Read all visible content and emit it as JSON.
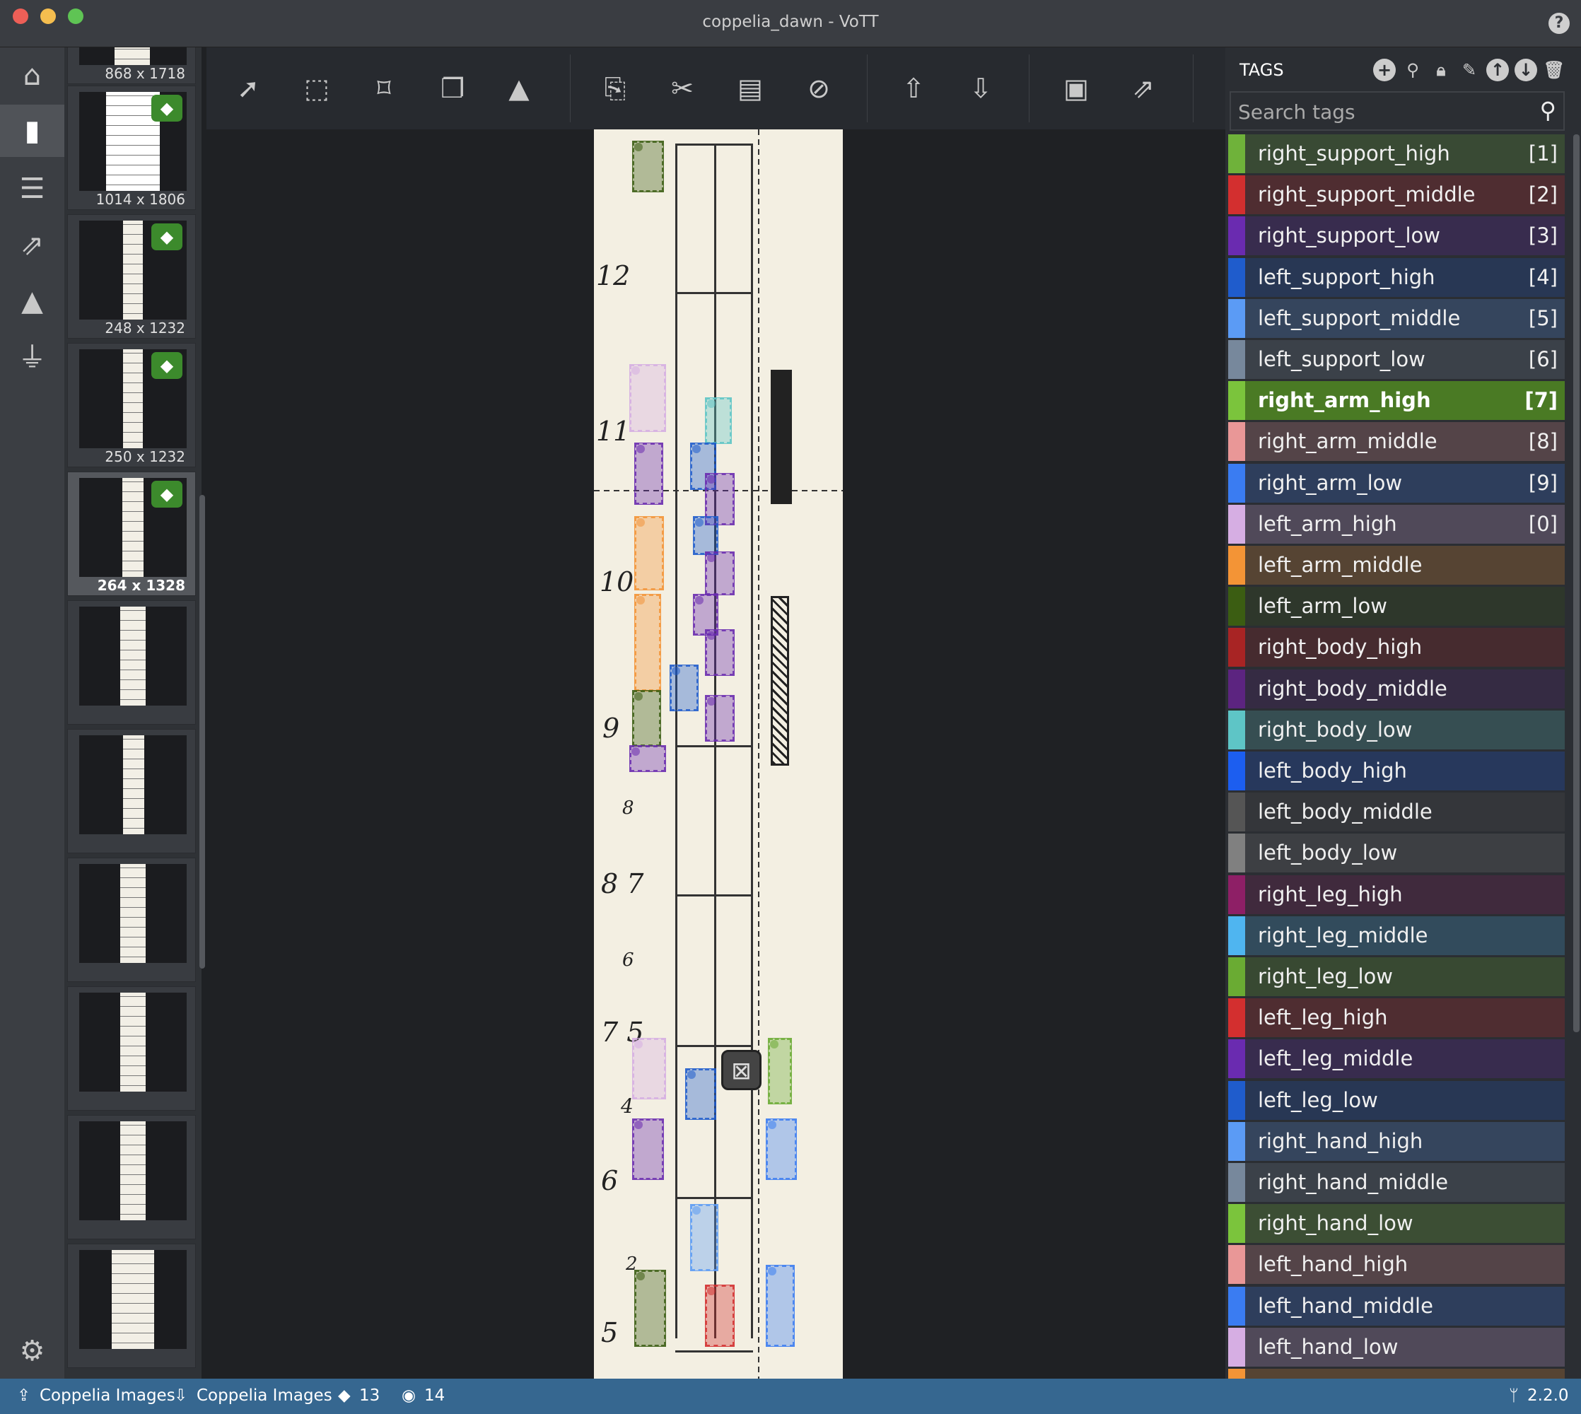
{
  "window": {
    "title": "coppelia_dawn - VoTT",
    "help_icon": "?"
  },
  "thumbnails": [
    {
      "size": "868 x 1718",
      "tagged": false
    },
    {
      "size": "1014 x 1806",
      "tagged": true
    },
    {
      "size": "248 x 1232",
      "tagged": true
    },
    {
      "size": "250 x 1232",
      "tagged": true
    },
    {
      "size": "264 x 1328",
      "tagged": true,
      "selected": true
    }
  ],
  "score_numbers": [
    "12",
    "11",
    "10",
    "9",
    "8",
    "8 7",
    "6",
    "7 5",
    "4",
    "6",
    "2",
    "5"
  ],
  "tags_panel": {
    "title": "TAGS",
    "search_placeholder": "Search tags",
    "tags": [
      {
        "name": "right_support_high",
        "key": "[1]",
        "color": "#6fb23a"
      },
      {
        "name": "right_support_middle",
        "key": "[2]",
        "color": "#d32f2f"
      },
      {
        "name": "right_support_low",
        "key": "[3]",
        "color": "#6a2bb0"
      },
      {
        "name": "left_support_high",
        "key": "[4]",
        "color": "#1f5ccc"
      },
      {
        "name": "left_support_middle",
        "key": "[5]",
        "color": "#5b9bf5"
      },
      {
        "name": "left_support_low",
        "key": "[6]",
        "color": "#77889c"
      },
      {
        "name": "right_arm_high",
        "key": "[7]",
        "color": "#7bc43c",
        "selected": true
      },
      {
        "name": "right_arm_middle",
        "key": "[8]",
        "color": "#e99797"
      },
      {
        "name": "right_arm_low",
        "key": "[9]",
        "color": "#3a7cf2"
      },
      {
        "name": "left_arm_high",
        "key": "[0]",
        "color": "#d6aee3"
      },
      {
        "name": "left_arm_middle",
        "key": "",
        "color": "#f39436"
      },
      {
        "name": "left_arm_low",
        "key": "",
        "color": "#3b5d12"
      },
      {
        "name": "right_body_high",
        "key": "",
        "color": "#a82424"
      },
      {
        "name": "right_body_middle",
        "key": "",
        "color": "#5c2480"
      },
      {
        "name": "right_body_low",
        "key": "",
        "color": "#5ec5c6"
      },
      {
        "name": "left_body_high",
        "key": "",
        "color": "#1c5ef0"
      },
      {
        "name": "left_body_middle",
        "key": "",
        "color": "#555555"
      },
      {
        "name": "left_body_low",
        "key": "",
        "color": "#808080"
      },
      {
        "name": "right_leg_high",
        "key": "",
        "color": "#8e1f66"
      },
      {
        "name": "right_leg_middle",
        "key": "",
        "color": "#4fb5f0"
      },
      {
        "name": "right_leg_low",
        "key": "",
        "color": "#6aab33"
      },
      {
        "name": "left_leg_high",
        "key": "",
        "color": "#d32f2f"
      },
      {
        "name": "left_leg_middle",
        "key": "",
        "color": "#6a2bb0"
      },
      {
        "name": "left_leg_low",
        "key": "",
        "color": "#1f5ccc"
      },
      {
        "name": "right_hand_high",
        "key": "",
        "color": "#5b9bf5"
      },
      {
        "name": "right_hand_middle",
        "key": "",
        "color": "#77889c"
      },
      {
        "name": "right_hand_low",
        "key": "",
        "color": "#7bc43c"
      },
      {
        "name": "left_hand_high",
        "key": "",
        "color": "#e99797"
      },
      {
        "name": "left_hand_middle",
        "key": "",
        "color": "#3a7cf2"
      },
      {
        "name": "left_hand_low",
        "key": "",
        "color": "#d6aee3"
      },
      {
        "name": "",
        "key": "",
        "color": "#f39436"
      }
    ]
  },
  "status": {
    "source": "Coppelia Images",
    "target": "Coppelia Images",
    "tag_count": "13",
    "visited_count": "14",
    "version": "2.2.0"
  }
}
